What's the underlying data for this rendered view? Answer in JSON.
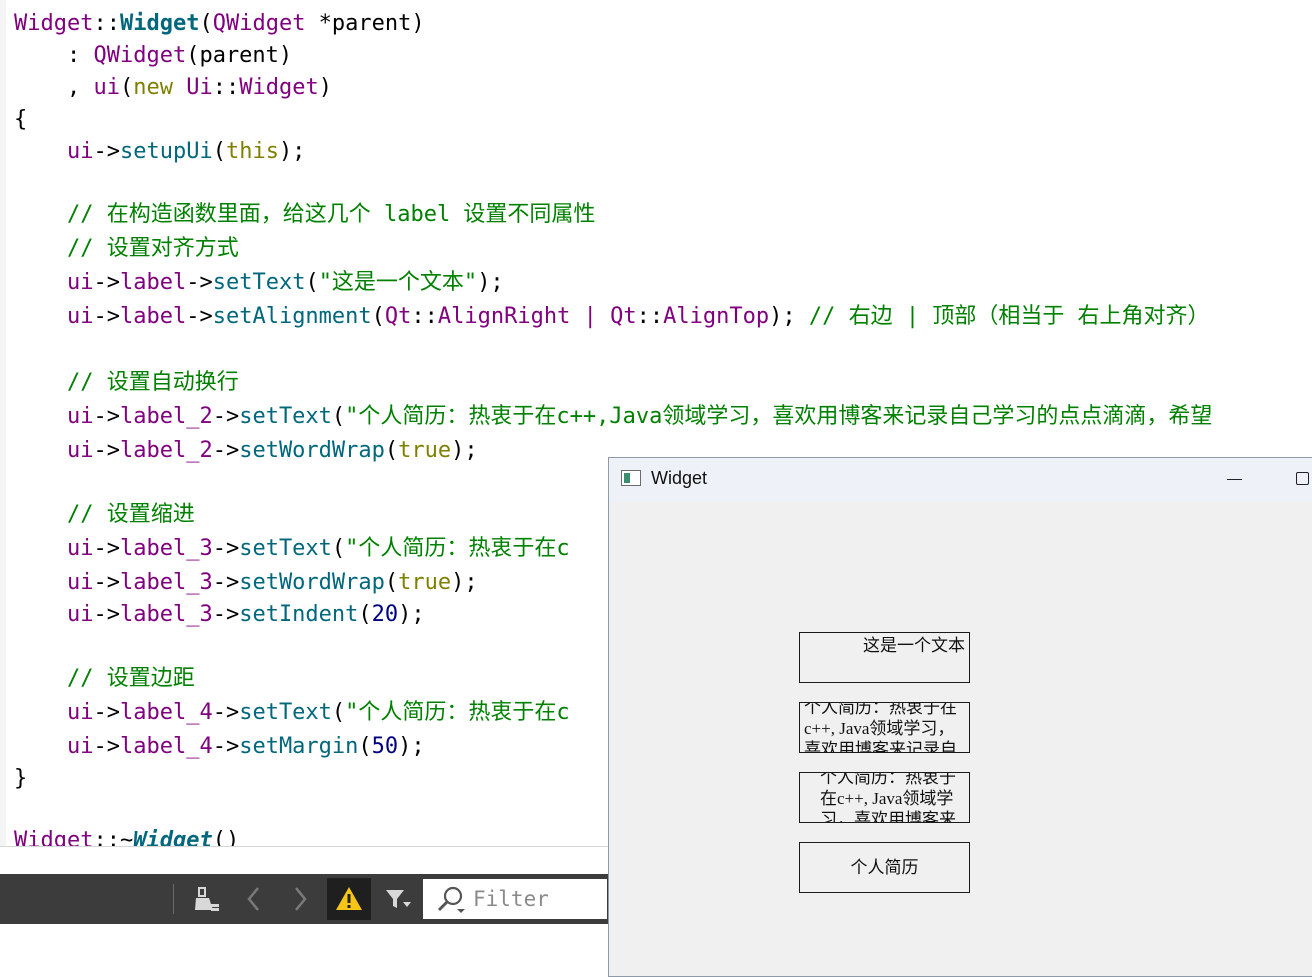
{
  "code": {
    "l1_class": "Widget",
    "l1_sep": "::",
    "l1_func": "Widget",
    "l1_paren_open": "(",
    "l1_type": "QWidget",
    "l1_arg": " *parent)",
    "l2_colon": "    : ",
    "l2_type": "QWidget",
    "l2_rest": "(parent)",
    "l3_comma": "    , ",
    "l3_ui": "ui",
    "l3_open": "(",
    "l3_new": "new",
    "l3_space": " ",
    "l3_ns": "Ui",
    "l3_sep": "::",
    "l3_type": "Widget",
    "l3_close": ")",
    "l4_brace": "{",
    "l5_indent": "    ",
    "l5_ui": "ui",
    "l5_arrow": "->",
    "l5_func": "setupUi",
    "l5_open": "(",
    "l5_this": "this",
    "l5_close": ");",
    "c1": "    // 在构造函数里面，给这几个 label 设置不同属性",
    "c2": "    // 设置对齐方式",
    "l8_indent": "    ",
    "l8_ui": "ui",
    "l8_a1": "->",
    "l8_member": "label",
    "l8_a2": "->",
    "l8_func": "setText",
    "l8_open": "(",
    "l8_str": "\"这是一个文本\"",
    "l8_close": ");",
    "l9_indent": "    ",
    "l9_ui": "ui",
    "l9_a1": "->",
    "l9_member": "label",
    "l9_a2": "->",
    "l9_func": "setAlignment",
    "l9_open": "(",
    "l9_ns1": "Qt",
    "l9_sep1": "::",
    "l9_en1": "AlignRight",
    "l9_pipe": " | ",
    "l9_ns2": "Qt",
    "l9_sep2": "::",
    "l9_en2": "AlignTop",
    "l9_close": "); ",
    "l9_comment": "// 右边 | 顶部（相当于 右上角对齐）",
    "c3": "    // 设置自动换行",
    "l12_indent": "    ",
    "l12_ui": "ui",
    "l12_a1": "->",
    "l12_member": "label_2",
    "l12_a2": "->",
    "l12_func": "setText",
    "l12_open": "(",
    "l12_str": "\"个人简历：热衷于在c++,Java领域学习，喜欢用博客来记录自己学习的点点滴滴，希望",
    "l13_indent": "    ",
    "l13_ui": "ui",
    "l13_a1": "->",
    "l13_member": "label_2",
    "l13_a2": "->",
    "l13_func": "setWordWrap",
    "l13_open": "(",
    "l13_true": "true",
    "l13_close": ");",
    "c4": "    // 设置缩进",
    "l16_indent": "    ",
    "l16_ui": "ui",
    "l16_a1": "->",
    "l16_member": "label_3",
    "l16_a2": "->",
    "l16_func": "setText",
    "l16_open": "(",
    "l16_str": "\"个人简历：热衷于在c",
    "l17_indent": "    ",
    "l17_ui": "ui",
    "l17_a1": "->",
    "l17_member": "label_3",
    "l17_a2": "->",
    "l17_func": "setWordWrap",
    "l17_open": "(",
    "l17_true": "true",
    "l17_close": ");",
    "l18_indent": "    ",
    "l18_ui": "ui",
    "l18_a1": "->",
    "l18_member": "label_3",
    "l18_a2": "->",
    "l18_func": "setIndent",
    "l18_open": "(",
    "l18_num": "20",
    "l18_close": ");",
    "c5": "    // 设置边距",
    "l21_indent": "    ",
    "l21_ui": "ui",
    "l21_a1": "->",
    "l21_member": "label_4",
    "l21_a2": "->",
    "l21_func": "setText",
    "l21_open": "(",
    "l21_str": "\"个人简历：热衷于在c",
    "l22_indent": "    ",
    "l22_ui": "ui",
    "l22_a1": "->",
    "l22_member": "label_4",
    "l22_a2": "->",
    "l22_func": "setMargin",
    "l22_open": "(",
    "l22_num": "50",
    "l22_close": ");",
    "l23_brace": "}",
    "l25_class": "Widget",
    "l25_sep": "::~",
    "l25_func": "Widget",
    "l25_rest": "()"
  },
  "issues_toolbar": {
    "filter_placeholder": "Filter",
    "icons": [
      "clean-icon",
      "chevron-left-icon",
      "chevron-right-icon",
      "warning-icon",
      "filter-funnel-icon",
      "search-icon"
    ],
    "warning_color": "#f5c518"
  },
  "preview_window": {
    "title": "Widget",
    "label1_text": "这是一个文本",
    "label2_text": "个人简历：热衷于在c++, Java领域学习，喜欢用博客来记录自",
    "label3_text": "个人简历：热衷于在c++, Java领域学习，喜欢用博客来",
    "label4_text": "个人简历"
  },
  "colors": {
    "keyword": "#808000",
    "type": "#800080",
    "function": "#00677c",
    "string": "#008000",
    "comment": "#008000",
    "number": "#000080",
    "toolbar_bg": "#3c3c3c"
  }
}
